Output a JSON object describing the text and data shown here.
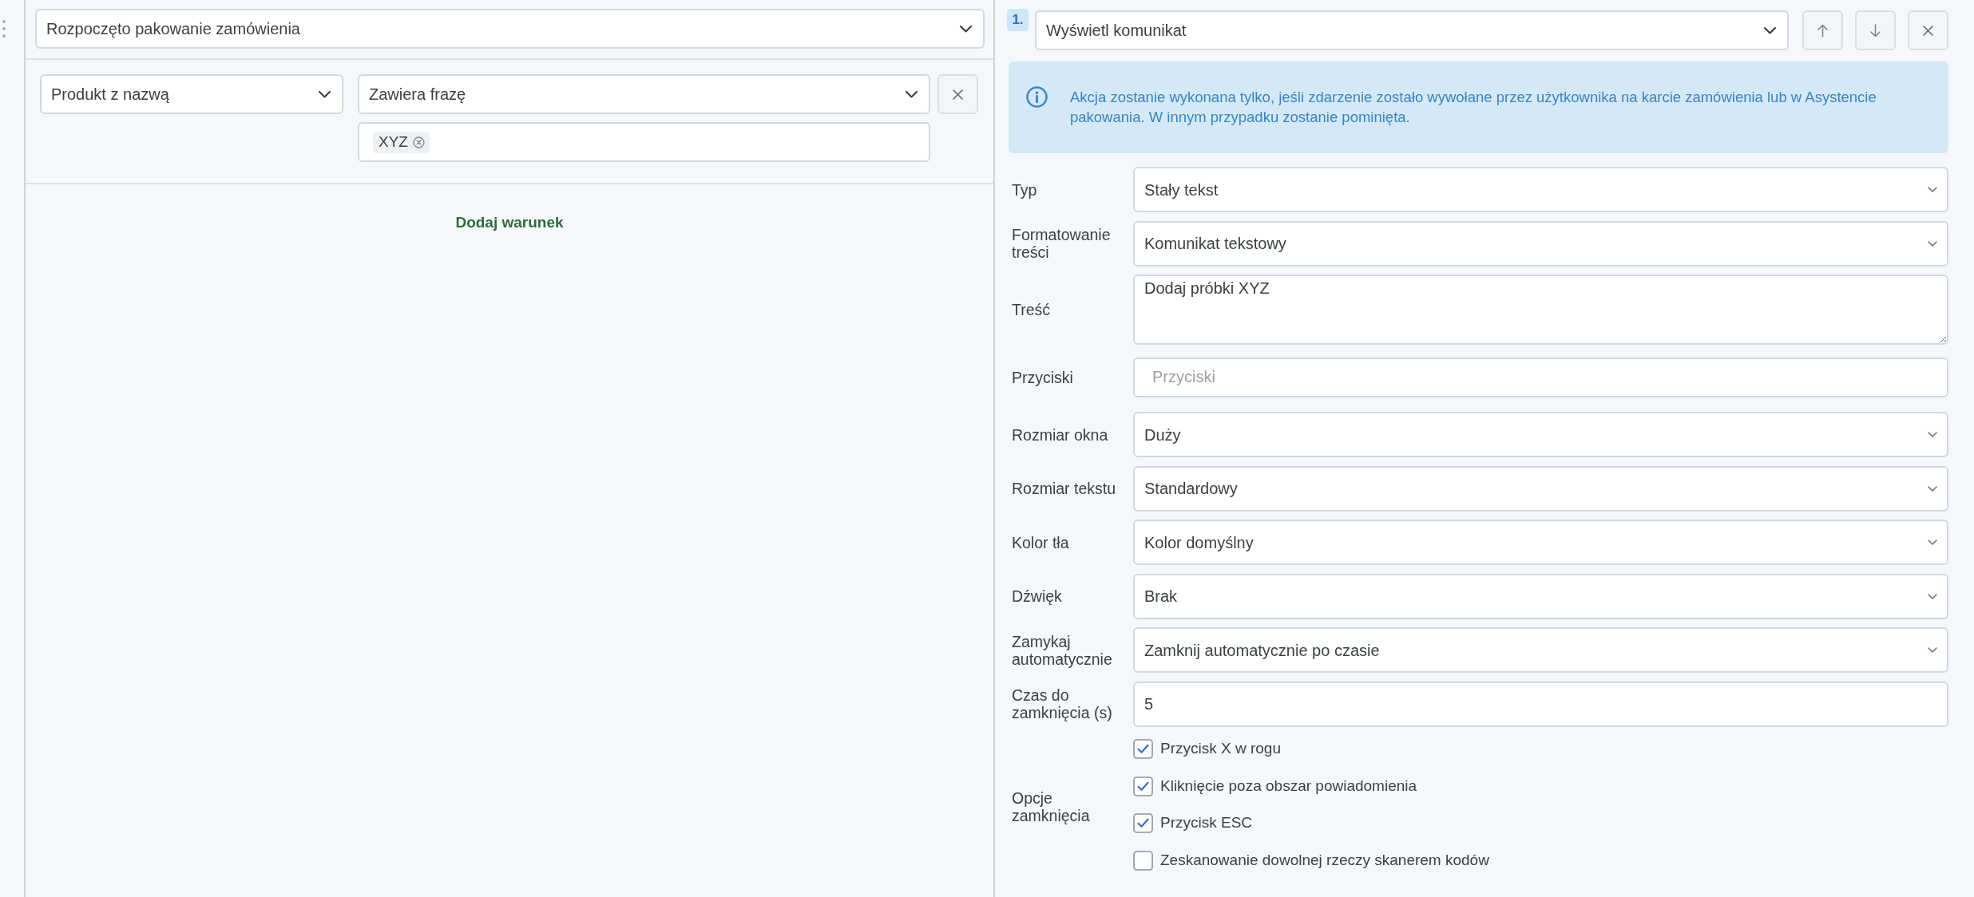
{
  "trigger": {
    "value": "Rozpoczęto pakowanie zamówienia"
  },
  "conditions": [
    {
      "field": "Produkt z nazwą",
      "operator": "Zawiera frazę",
      "tags": [
        "XYZ"
      ]
    }
  ],
  "add_condition": "Dodaj warunek",
  "actions": [
    {
      "number": "1.",
      "type": "Wyświetl komunikat",
      "info": "Akcja zostanie wykonana tylko, jeśli zdarzenie zostało wywołane przez użytkownika na karcie zamówienia lub w Asystencie pakowania. W innym przypadku zostanie pominięta.",
      "fields": [
        {
          "kind": "select",
          "label": "Typ",
          "value": "Stały tekst"
        },
        {
          "kind": "select",
          "label": "Formatowanie treści",
          "value": "Komunikat tekstowy"
        },
        {
          "kind": "textarea",
          "label": "Treść",
          "value": "Dodaj próbki XYZ"
        },
        {
          "kind": "tags",
          "label": "Przyciski",
          "placeholder": "Przyciski"
        },
        {
          "kind": "select",
          "label": "Rozmiar okna",
          "value": "Duży"
        },
        {
          "kind": "select",
          "label": "Rozmiar tekstu",
          "value": "Standardowy"
        },
        {
          "kind": "select",
          "label": "Kolor tła",
          "value": "Kolor domyślny"
        },
        {
          "kind": "select",
          "label": "Dźwięk",
          "value": "Brak"
        },
        {
          "kind": "select",
          "label": "Zamykaj automatycznie",
          "value": "Zamknij automatycznie po czasie"
        },
        {
          "kind": "input",
          "label": "Czas do zamknięcia (s)",
          "value": "5"
        },
        {
          "kind": "checkboxes",
          "label": "Opcje zamknięcia",
          "options": [
            {
              "label": "Przycisk X w rogu",
              "checked": true
            },
            {
              "label": "Kliknięcie poza obszar powiadomienia",
              "checked": true
            },
            {
              "label": "Przycisk ESC",
              "checked": true
            },
            {
              "label": "Zeskanowanie dowolnej rzeczy skanerem kodów",
              "checked": false
            }
          ]
        }
      ]
    }
  ]
}
